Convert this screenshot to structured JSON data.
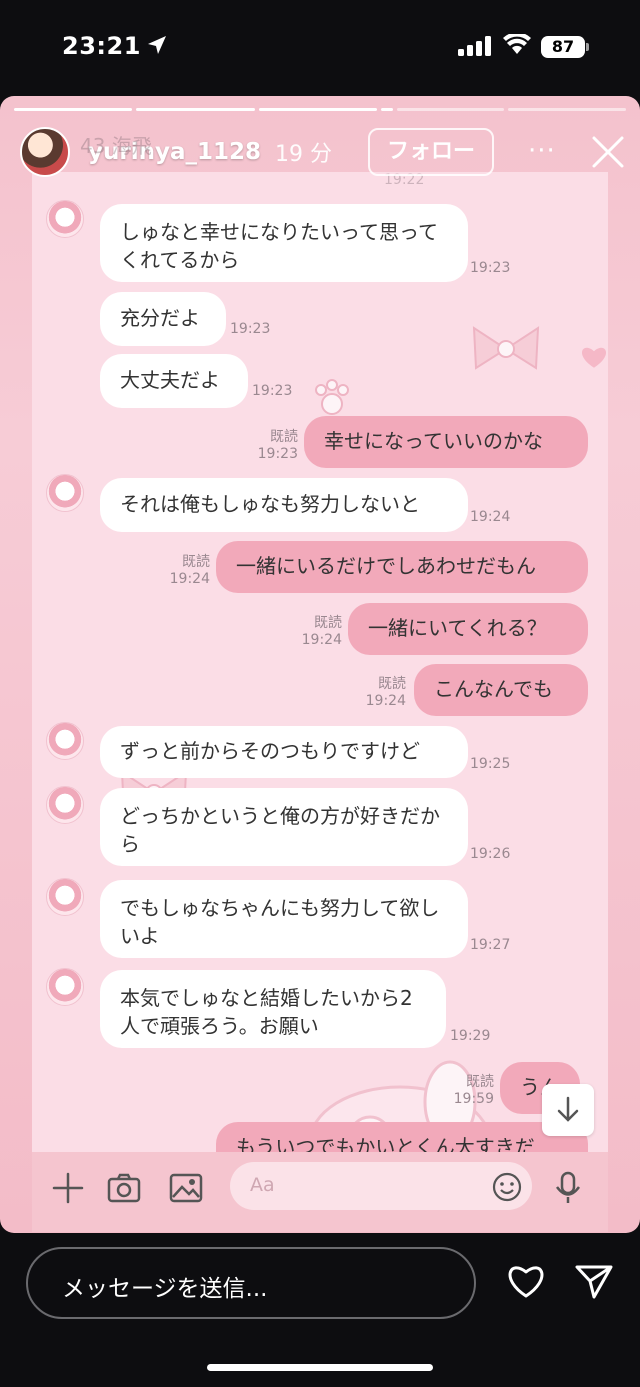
{
  "status_bar": {
    "time": "23:21",
    "battery": "87"
  },
  "story": {
    "username": "yurinya_1128",
    "time_ago": "19 分",
    "follow_label": "フォロー",
    "more": "···",
    "ghost_header": "43 海飛",
    "ghost_top_time": "19:22"
  },
  "messages": [
    {
      "side": "in",
      "text": "しゅなと幸せになりたいって思ってくれてるから",
      "time": "19:23",
      "read": ""
    },
    {
      "side": "in",
      "text": "充分だよ",
      "time": "19:23",
      "read": ""
    },
    {
      "side": "in",
      "text": "大丈夫だよ",
      "time": "19:23",
      "read": ""
    },
    {
      "side": "out",
      "text": "幸せになっていいのかな",
      "time": "19:23",
      "read": "既読"
    },
    {
      "side": "in",
      "text": "それは俺もしゅなも努力しないと",
      "time": "19:24",
      "read": ""
    },
    {
      "side": "out",
      "text": "一緒にいるだけでしあわせだもん",
      "time": "19:24",
      "read": "既読"
    },
    {
      "side": "out",
      "text": "一緒にいてくれる？",
      "time": "19:24",
      "read": "既読"
    },
    {
      "side": "out",
      "text": "こんなんでも",
      "time": "19:24",
      "read": "既読"
    },
    {
      "side": "in",
      "text": "ずっと前からそのつもりですけど",
      "time": "19:25",
      "read": ""
    },
    {
      "side": "in",
      "text": "どっちかというと俺の方が好きだから",
      "time": "19:26",
      "read": ""
    },
    {
      "side": "in",
      "text": "でもしゅなちゃんにも努力して欲しいよ",
      "time": "19:27",
      "read": ""
    },
    {
      "side": "in",
      "text": "本気でしゅなと結婚したいから2人で頑張ろう。お願い",
      "time": "19:29",
      "read": ""
    },
    {
      "side": "out",
      "text": "うん",
      "time": "19:59",
      "read": "既読"
    },
    {
      "side": "out",
      "text": "もういつでもかいとくん大すきだ",
      "time": "",
      "read": ""
    }
  ],
  "chat_input": {
    "placeholder": "Aa"
  },
  "bottom_bar": {
    "message_placeholder": "メッセージを送信..."
  }
}
